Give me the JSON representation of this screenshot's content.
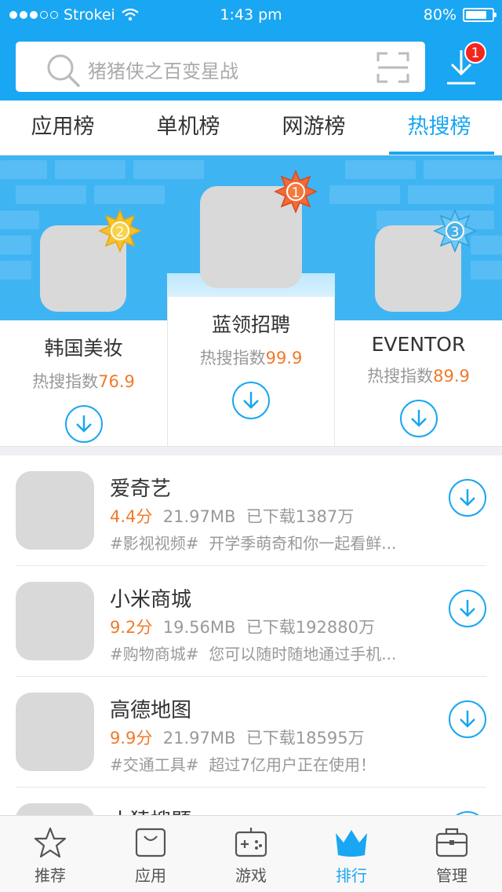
{
  "status_bar": {
    "carrier": "Strokei",
    "time": "1:43 pm",
    "battery": "80%"
  },
  "search": {
    "placeholder": "猪猪侠之百变星战"
  },
  "download_badge": "1",
  "tabs": [
    {
      "label": "应用榜",
      "active": false
    },
    {
      "label": "单机榜",
      "active": false
    },
    {
      "label": "网游榜",
      "active": false
    },
    {
      "label": "热搜榜",
      "active": true
    }
  ],
  "podium": {
    "index_label": "热搜指数",
    "first": {
      "rank": "1",
      "name": "蓝领招聘",
      "score": "99.9"
    },
    "second": {
      "rank": "2",
      "name": "韩国美妆",
      "score": "76.9"
    },
    "third": {
      "rank": "3",
      "name": "EVENTOR",
      "score": "89.9"
    }
  },
  "list": [
    {
      "name": "爱奇艺",
      "score": "4.4分",
      "size": "21.97MB",
      "downloads": "已下载1387万",
      "tag": "#影视视频#",
      "desc": "开学季萌奇和你一起看鲜..."
    },
    {
      "name": "小米商城",
      "score": "9.2分",
      "size": "19.56MB",
      "downloads": "已下载192880万",
      "tag": "#购物商城#",
      "desc": "您可以随时随地通过手机..."
    },
    {
      "name": "高德地图",
      "score": "9.9分",
      "size": "21.97MB",
      "downloads": "已下载18595万",
      "tag": "#交通工具#",
      "desc": "超过7亿用户正在使用！"
    },
    {
      "name": "小猿搜题",
      "score": "",
      "size": "",
      "downloads": "",
      "tag": "",
      "desc": ""
    }
  ],
  "bottom_nav": [
    {
      "label": "推荐",
      "icon": "star-icon",
      "active": false
    },
    {
      "label": "应用",
      "icon": "bag-icon",
      "active": false
    },
    {
      "label": "游戏",
      "icon": "gamepad-icon",
      "active": false
    },
    {
      "label": "排行",
      "icon": "crown-icon",
      "active": true
    },
    {
      "label": "管理",
      "icon": "toolbox-icon",
      "active": false
    }
  ],
  "colors": {
    "primary": "#19a6f2",
    "accent": "#f07a2a",
    "badge": "#f2261d"
  }
}
